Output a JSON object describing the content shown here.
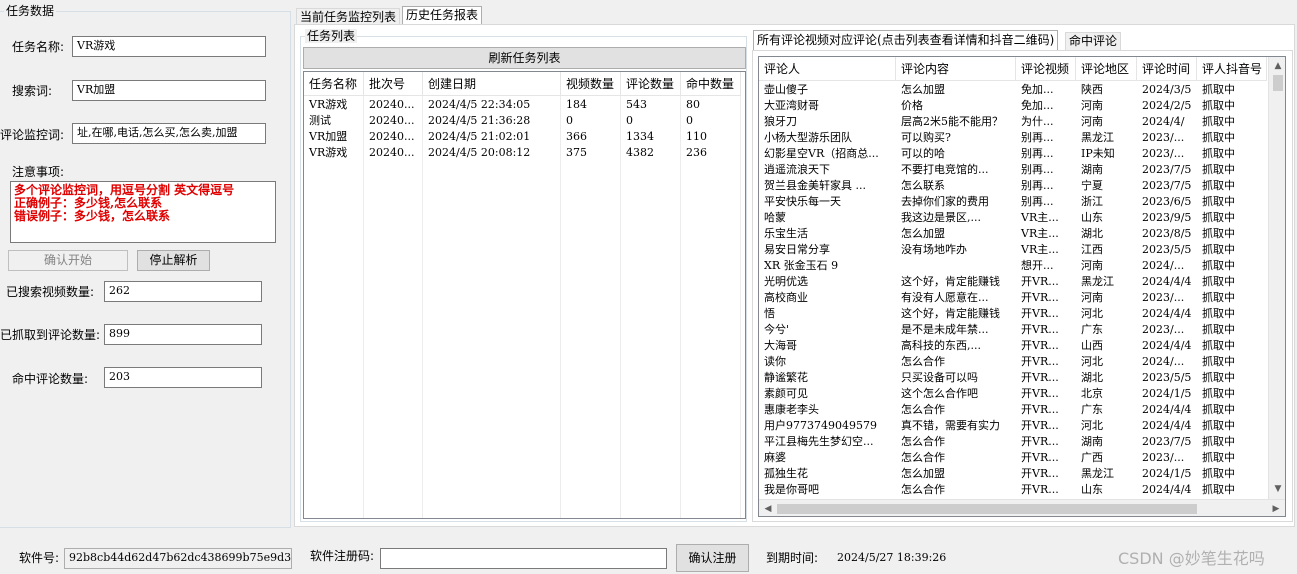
{
  "task_group": {
    "title": "任务数据",
    "task_name_label": "任务名称:",
    "task_name_value": "VR游戏",
    "search_word_label": "搜索词:",
    "search_word_value": "VR加盟",
    "comment_monitor_label": "评论监控词:",
    "comment_monitor_value": "址,在哪,电话,怎么买,怎么卖,加盟",
    "notes_label": "注意事项:",
    "notes_lines": [
      "多个评论监控词，用逗号分割 英文得逗号",
      "正确例子：多少钱,怎么联系",
      "错误例子：多少钱，怎么联系"
    ],
    "start_button": "确认开始",
    "stop_button": "停止解析",
    "searched_label": "已搜索视频数量:",
    "searched_value": "262",
    "captured_label": "已抓取到评论数量:",
    "captured_value": "899",
    "hit_label": "命中评论数量:",
    "hit_value": "203"
  },
  "tabs": {
    "current": "当前任务监控列表",
    "history": "历史任务报表"
  },
  "task_list": {
    "title": "任务列表",
    "refresh_button": "刷新任务列表",
    "columns": [
      "任务名称",
      "批次号",
      "创建日期",
      "视频数量",
      "评论数量",
      "命中数量"
    ],
    "rows": [
      [
        "VR游戏",
        "20240...",
        "2024/4/5 22:34:05",
        "184",
        "543",
        "80"
      ],
      [
        "测试",
        "20240...",
        "2024/4/5 21:36:28",
        "0",
        "0",
        "0"
      ],
      [
        "VR加盟",
        "20240...",
        "2024/4/5 21:02:01",
        "366",
        "1334",
        "110"
      ],
      [
        "VR游戏",
        "20240...",
        "2024/4/5 20:08:12",
        "375",
        "4382",
        "236"
      ]
    ]
  },
  "right_tabs": {
    "all_comments": "所有评论视频对应评论(点击列表查看详情和抖音二维码)",
    "hit_comments": "命中评论"
  },
  "comments": {
    "columns": [
      "评论人",
      "评论内容",
      "评论视频",
      "评论地区",
      "评论时间",
      "评人抖音号"
    ],
    "rows": [
      [
        "壶山傻子",
        "怎么加盟",
        "免加...",
        "陕西",
        "2024/3/5",
        "抓取中"
      ],
      [
        "大亚湾财哥",
        "价格",
        "免加...",
        "河南",
        "2024/2/5",
        "抓取中"
      ],
      [
        "狼牙刀",
        "层高2米5能不能用？",
        "为什...",
        "河南",
        "2024/4/",
        "抓取中"
      ],
      [
        "小杨大型游乐团队",
        "可以购买?",
        "别再...",
        "黑龙江",
        "2023/...",
        "抓取中"
      ],
      [
        "幻影星空VR（招商总...",
        "可以的哈",
        "别再...",
        "IP未知",
        "2023/...",
        "抓取中"
      ],
      [
        "逍遥流浪天下",
        "不要打电竞馆的...",
        "别再...",
        "湖南",
        "2023/7/5",
        "抓取中"
      ],
      [
        "贺兰县金美轩家具  ...",
        "怎么联系",
        "别再...",
        "宁夏",
        "2023/7/5",
        "抓取中"
      ],
      [
        "平安快乐每一天",
        "去掉你们家的费用",
        "别再...",
        "浙江",
        "2023/6/5",
        "抓取中"
      ],
      [
        "哈蒙",
        "我这边是景区,...",
        "VR主...",
        "山东",
        "2023/9/5",
        "抓取中"
      ],
      [
        "乐宝生活",
        "怎么加盟",
        "VR主...",
        "湖北",
        "2023/8/5",
        "抓取中"
      ],
      [
        "易安日常分享",
        "没有场地咋办",
        "VR主...",
        "江西",
        "2023/5/5",
        "抓取中"
      ],
      [
        "XR 张金玉石 9",
        "",
        "想开...",
        "河南",
        "2024/...",
        "抓取中"
      ],
      [
        "光明优选",
        "这个好，肯定能赚钱",
        "开VR...",
        "黑龙江",
        "2024/4/4",
        "抓取中"
      ],
      [
        "高校商业",
        "有没有人愿意在...",
        "开VR...",
        "河南",
        "2023/...",
        "抓取中"
      ],
      [
        "悟",
        "这个好，肯定能赚钱",
        "开VR...",
        "河北",
        "2024/4/4",
        "抓取中"
      ],
      [
        "今兮'",
        "是不是未成年禁...",
        "开VR...",
        "广东",
        "2023/...",
        "抓取中"
      ],
      [
        "大海哥",
        "高科技的东西,...",
        "开VR...",
        "山西",
        "2024/4/4",
        "抓取中"
      ],
      [
        "读你",
        "怎么合作",
        "开VR...",
        "河北",
        "2024/...",
        "抓取中"
      ],
      [
        "静谧繁花",
        "只买设备可以吗",
        "开VR...",
        "湖北",
        "2023/5/5",
        "抓取中"
      ],
      [
        "素颜可见",
        "这个怎么合作吧",
        "开VR...",
        "北京",
        "2024/1/5",
        "抓取中"
      ],
      [
        "惠康老李头",
        "怎么合作",
        "开VR...",
        "广东",
        "2024/4/4",
        "抓取中"
      ],
      [
        "用户9773749049579",
        "真不错，需要有实力",
        "开VR...",
        "河北",
        "2024/4/4",
        "抓取中"
      ],
      [
        "平江县梅先生梦幻空...",
        "怎么合作",
        "开VR...",
        "湖南",
        "2023/7/5",
        "抓取中"
      ],
      [
        "麻婆",
        "怎么合作",
        "开VR...",
        "广西",
        "2023/...",
        "抓取中"
      ],
      [
        "孤独生花",
        "怎么加盟",
        "开VR...",
        "黑龙江",
        "2024/1/5",
        "抓取中"
      ],
      [
        "我是你哥吧",
        "怎么合作",
        "开VR...",
        "山东",
        "2024/4/4",
        "抓取中"
      ]
    ]
  },
  "footer": {
    "software_no_label": "软件号:",
    "software_no_value": "92b8cb44d62d47b62dc438699b75e9d3",
    "reg_code_label": "软件注册码:",
    "reg_code_value": "",
    "confirm_reg_button": "确认注册",
    "expire_label": "到期时间:",
    "expire_value": "2024/5/27 18:39:26"
  },
  "watermark": "CSDN @妙笔生花吗"
}
